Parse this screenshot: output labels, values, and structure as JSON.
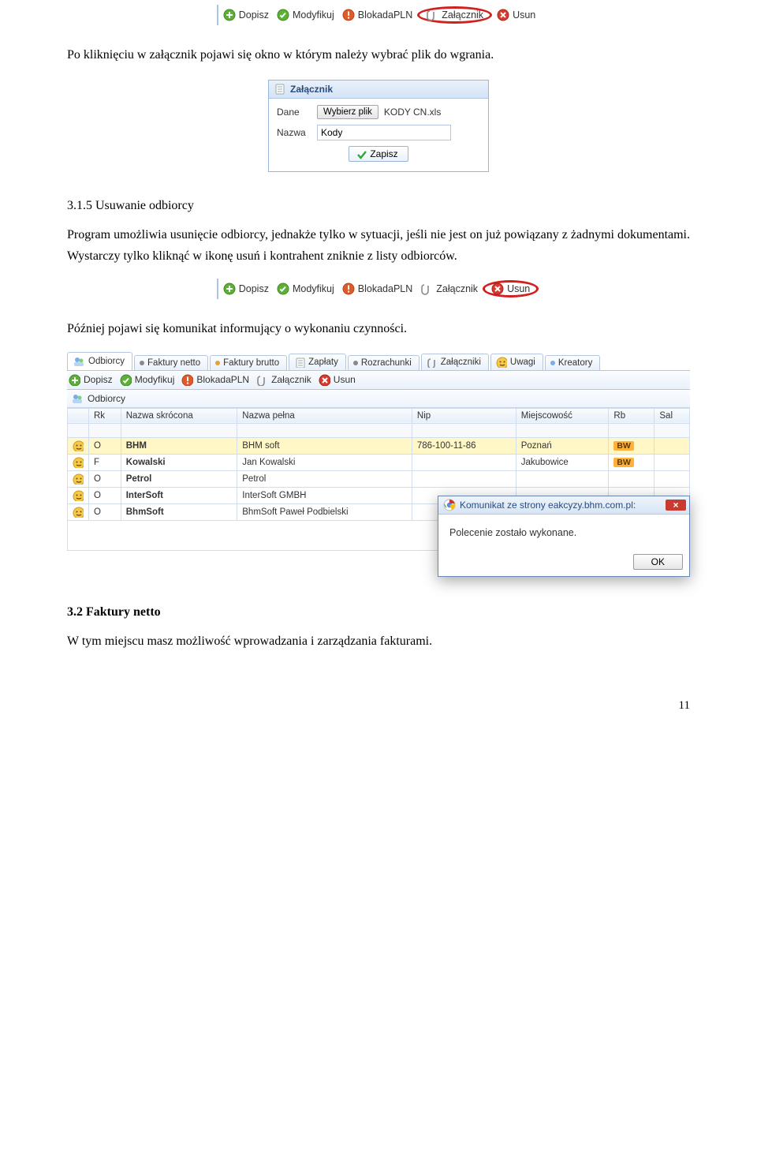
{
  "toolbar_top": {
    "dopisz": "Dopisz",
    "modyfikuj": "Modyfikuj",
    "blokada": "BlokadaPLN",
    "zalacznik": "Załącznik",
    "usun": "Usun"
  },
  "para1": "Po kliknięciu w załącznik pojawi się okno w którym należy wybrać plik do wgrania.",
  "dlg": {
    "title": "Załącznik",
    "dane_label": "Dane",
    "wybierz_label": "Wybierz plik",
    "file_name": "KODY CN.xls",
    "nazwa_label": "Nazwa",
    "nazwa_value": "Kody",
    "zapisz_label": "Zapisz"
  },
  "sec315_head": "3.1.5    Usuwanie odbiorcy",
  "sec315_body": "Program umożliwia usunięcie odbiorcy, jednakże tylko w sytuacji, jeśli nie jest on już powiązany z żadnymi dokumentami.  Wystarczy tylko kliknąć w ikonę usuń i kontrahent zniknie z listy odbiorców.",
  "toolbar_mid": {
    "dopisz": "Dopisz",
    "modyfikuj": "Modyfikuj",
    "blokada": "BlokadaPLN",
    "zalacznik": "Załącznik",
    "usun": "Usun"
  },
  "para3": "Później pojawi się komunikat informujący o wykonaniu czynności.",
  "tabs": {
    "odbiorcy": "Odbiorcy",
    "faktury_netto": "Faktury netto",
    "faktury_brutto": "Faktury brutto",
    "zaplaty": "Zapłaty",
    "rozrachunki": "Rozrachunki",
    "zalaczniki": "Załączniki",
    "uwagi": "Uwagi",
    "kreatory": "Kreatory"
  },
  "actions": {
    "dopisz": "Dopisz",
    "modyfikuj": "Modyfikuj",
    "blokada": "BlokadaPLN",
    "zalacznik": "Załącznik",
    "usun": "Usun"
  },
  "panel_title": "Odbiorcy",
  "cols": {
    "rk": "Rk",
    "nazwa_skr": "Nazwa skrócona",
    "nazwa_pelna": "Nazwa pełna",
    "nip": "Nip",
    "miejscowosc": "Miejscowość",
    "rb": "Rb",
    "sal": "Sal"
  },
  "rows": [
    {
      "rk": "O",
      "ns": "BHM",
      "np": "BHM soft",
      "nip": "786-100-11-86",
      "miej": "Poznań",
      "rb": "BW"
    },
    {
      "rk": "F",
      "ns": "Kowalski",
      "np": "Jan Kowalski",
      "nip": "",
      "miej": "Jakubowice",
      "rb": "BW"
    },
    {
      "rk": "O",
      "ns": "Petrol",
      "np": "Petrol",
      "nip": "",
      "miej": "",
      "rb": ""
    },
    {
      "rk": "O",
      "ns": "InterSoft",
      "np": "InterSoft GMBH",
      "nip": "",
      "miej": "",
      "rb": ""
    },
    {
      "rk": "O",
      "ns": "BhmSoft",
      "np": "BhmSoft Paweł Podbielski",
      "nip": "",
      "miej": "",
      "rb": ""
    }
  ],
  "alert": {
    "title": "Komunikat ze strony eakcyzy.bhm.com.pl:",
    "body": "Polecenie zostało wykonane.",
    "ok": "OK"
  },
  "sec32_head": "3.2 Faktury netto",
  "sec32_body": "W tym miejscu masz możliwość wprowadzania i zarządzania fakturami.",
  "page_no": "11"
}
